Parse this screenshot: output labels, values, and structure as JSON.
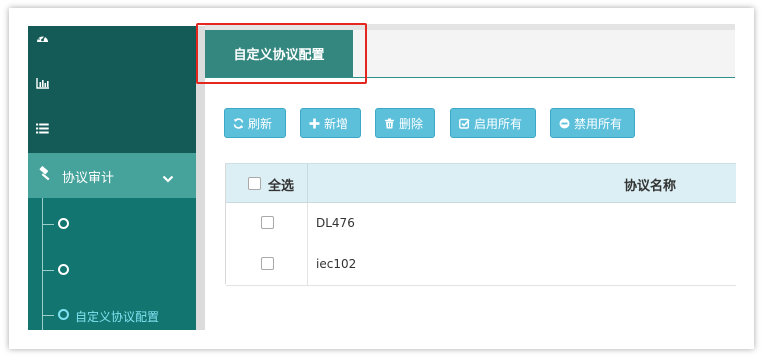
{
  "sidebar": {
    "top_icons": [
      "dashboard-gauge-icon",
      "bar-chart-icon",
      "list-icon"
    ],
    "audit_menu": {
      "label": "协议审计",
      "icon": "hammer-icon",
      "expanded": true
    },
    "sub_items": [
      {
        "label": ""
      },
      {
        "label": ""
      },
      {
        "label": "自定义协议配置",
        "active": true
      }
    ]
  },
  "tabs": [
    {
      "label": "自定义协议配置",
      "active": true
    }
  ],
  "toolbar": {
    "refresh_label": "刷新",
    "add_label": "新增",
    "delete_label": "删除",
    "enable_all_label": "启用所有",
    "disable_all_label": "禁用所有"
  },
  "table": {
    "select_all_label": "全选",
    "columns": [
      "协议名称"
    ],
    "rows": [
      {
        "name": "DL476",
        "checked": false
      },
      {
        "name": "iec102",
        "checked": false
      }
    ]
  },
  "colors": {
    "sidebar_dark": "#145a56",
    "sidebar_main": "#137570",
    "menu_active": "#46a39c",
    "tab_active": "#34877f",
    "button": "#5cc0db",
    "highlight": "#e5261f",
    "submenu_active_text": "#7fe3f1"
  }
}
